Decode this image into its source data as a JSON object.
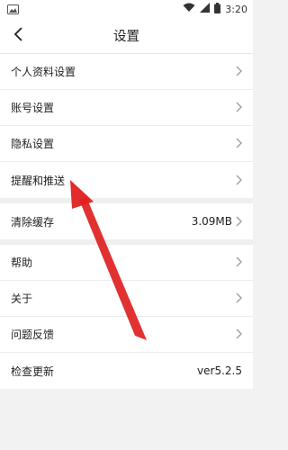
{
  "status_bar": {
    "time": "3:20",
    "icons": [
      "image-icon",
      "wifi-icon",
      "signal-icon",
      "battery-icon"
    ]
  },
  "nav": {
    "title": "设置",
    "back_icon": "chevron-left-icon"
  },
  "groups": [
    {
      "items": [
        {
          "label": "个人资料设置",
          "has_arrow": true
        },
        {
          "label": "账号设置",
          "has_arrow": true
        },
        {
          "label": "隐私设置",
          "has_arrow": true
        },
        {
          "label": "提醒和推送",
          "has_arrow": true
        }
      ]
    },
    {
      "items": [
        {
          "label": "清除缓存",
          "value": "3.09MB",
          "has_arrow": true
        }
      ]
    },
    {
      "items": [
        {
          "label": "帮助",
          "has_arrow": true
        },
        {
          "label": "关于",
          "has_arrow": true
        },
        {
          "label": "问题反馈",
          "has_arrow": true
        },
        {
          "label": "检查更新",
          "value": "ver5.2.5",
          "has_arrow": false
        }
      ]
    }
  ],
  "annotation": {
    "type": "red-arrow",
    "color": "#e02020",
    "points_to": "提醒和推送"
  }
}
